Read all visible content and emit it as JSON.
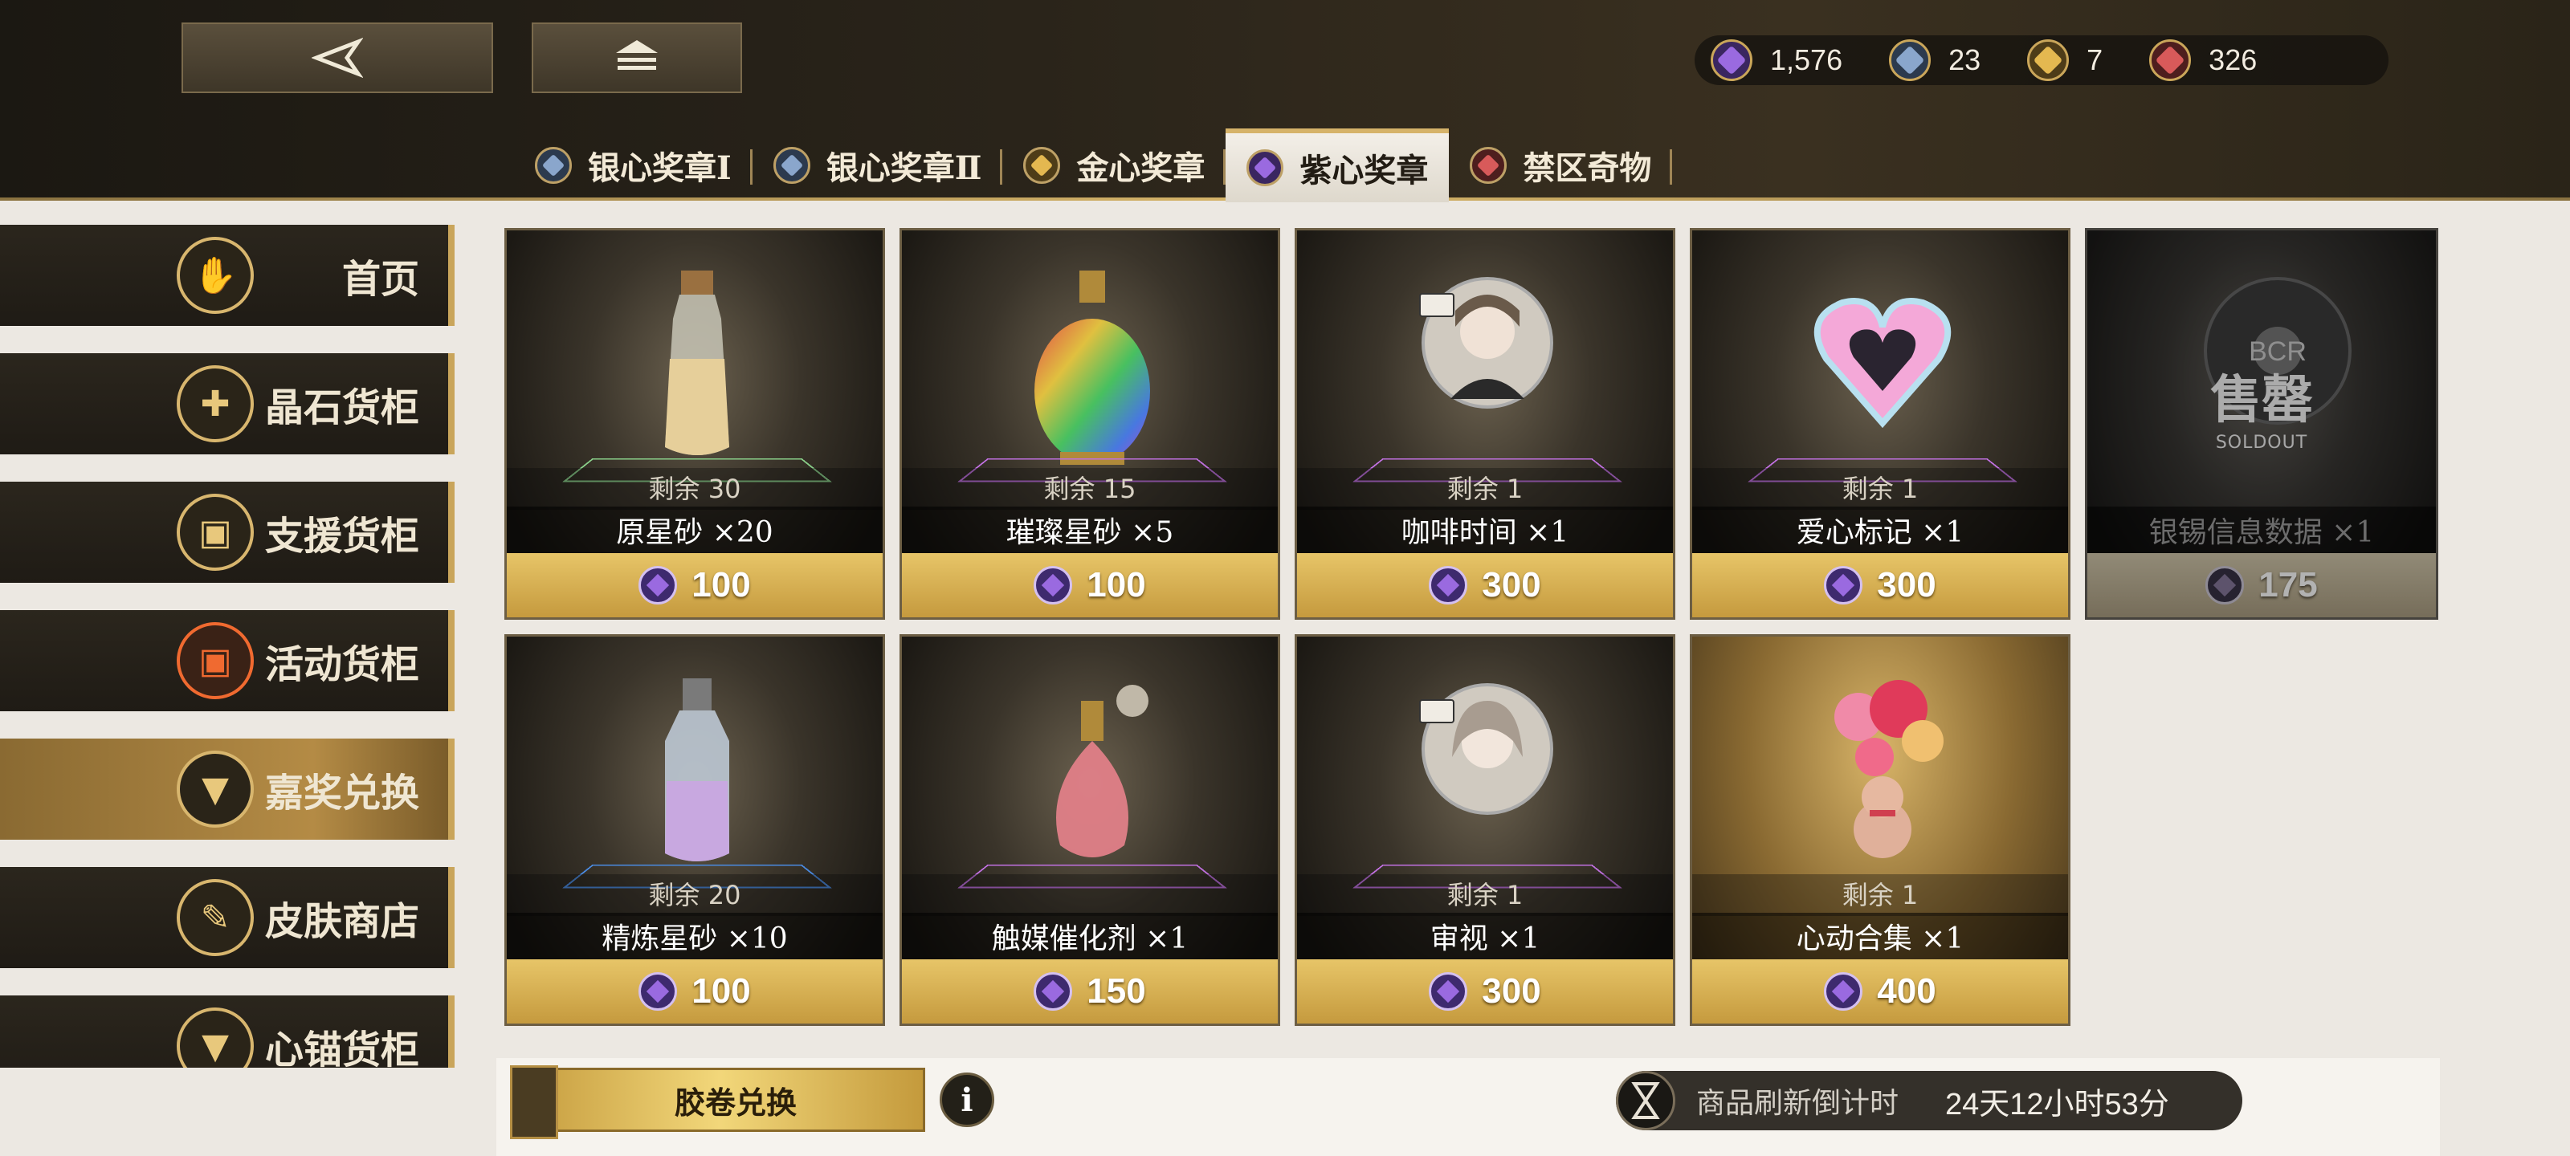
{
  "header": {
    "back_icon": "back-arrow-icon",
    "home_icon": "home-icon",
    "currencies": [
      {
        "icon": "purple-gem-icon",
        "value": "1,576",
        "color": "#7a4fd0"
      },
      {
        "icon": "silver-gem-icon",
        "value": "23",
        "color": "#6f8ab0"
      },
      {
        "icon": "gold-gem-icon",
        "value": "7",
        "color": "#d0a040"
      },
      {
        "icon": "red-gem-icon",
        "value": "326",
        "color": "#c04848"
      }
    ]
  },
  "tabs": [
    {
      "label": "银心奖章Ⅰ",
      "color": "#6f8ab0"
    },
    {
      "label": "银心奖章Ⅱ",
      "color": "#6f8ab0"
    },
    {
      "label": "金心奖章",
      "color": "#d0a040"
    },
    {
      "label": "紫心奖章",
      "color": "#7a4fd0",
      "active": true
    },
    {
      "label": "禁区奇物",
      "color": "#c04848"
    }
  ],
  "sidebar": [
    {
      "label": "首页",
      "icon": "thumbs-up-icon"
    },
    {
      "label": "晶石货柜",
      "icon": "crystal-icon"
    },
    {
      "label": "支援货柜",
      "icon": "box-icon"
    },
    {
      "label": "活动货柜",
      "icon": "event-box-icon"
    },
    {
      "label": "嘉奖兑换",
      "icon": "medal-icon",
      "active": true
    },
    {
      "label": "皮肤商店",
      "icon": "suit-icon"
    },
    {
      "label": "心锚货柜",
      "icon": "anchor-icon"
    }
  ],
  "items": [
    {
      "remain": "剩余 30",
      "name": "原星砂 ×20",
      "price": "100"
    },
    {
      "remain": "剩余 15",
      "name": "璀璨星砂 ×5",
      "price": "100"
    },
    {
      "remain": "剩余 1",
      "name": "咖啡时间 ×1",
      "price": "300"
    },
    {
      "remain": "剩余 1",
      "name": "爱心标记 ×1",
      "price": "300"
    },
    {
      "remain": "",
      "name": "银锡信息数据 ×1",
      "price": "175",
      "soldout_cn": "售罄",
      "soldout_en": "SOLDOUT",
      "logo": "BCR"
    },
    {
      "remain": "剩余 20",
      "name": "精炼星砂 ×10",
      "price": "100"
    },
    {
      "remain": "",
      "name": "触媒催化剂 ×1",
      "price": "150"
    },
    {
      "remain": "剩余 1",
      "name": "审视 ×1",
      "price": "300"
    },
    {
      "remain": "剩余 1",
      "name": "心动合集 ×1",
      "price": "400"
    }
  ],
  "footer": {
    "film_exchange": "胶卷兑换",
    "info": "i",
    "refresh_label": "商品刷新倒计时",
    "refresh_time": "24天12小时53分"
  }
}
